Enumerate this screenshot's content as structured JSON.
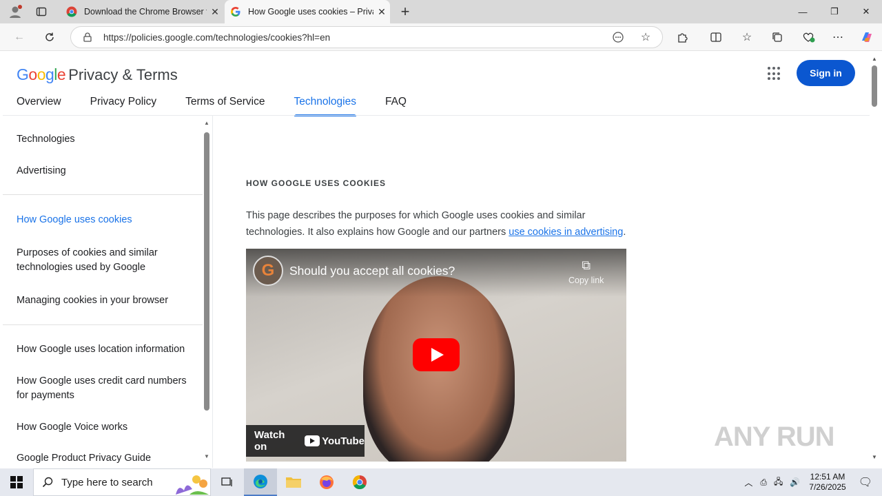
{
  "browser": {
    "tabs": [
      {
        "title": "Download the Chrome Browser for",
        "active": false
      },
      {
        "title": "How Google uses cookies – Privacy",
        "active": true
      }
    ],
    "url": "https://policies.google.com/technologies/cookies?hl=en"
  },
  "header": {
    "logo_google": "Google",
    "logo_suffix": "Privacy & Terms",
    "signin": "Sign in",
    "nav": [
      "Overview",
      "Privacy Policy",
      "Terms of Service",
      "Technologies",
      "FAQ"
    ],
    "active_nav": "Technologies"
  },
  "sidebar": {
    "items": [
      "Technologies",
      "Advertising",
      "How Google uses cookies",
      "Purposes of cookies and similar technologies used by Google",
      "Managing cookies in your browser",
      "How Google uses location information",
      "How Google uses credit card numbers for payments",
      "How Google Voice works",
      "Google Product Privacy Guide"
    ],
    "active_item": "How Google uses cookies"
  },
  "content": {
    "kicker": "HOW GOOGLE USES COOKIES",
    "para_before": "This page describes the purposes for which Google uses cookies and similar technologies. It also explains how Google and our partners ",
    "para_link": "use cookies in advertising",
    "para_after": ".",
    "video": {
      "channel_initial": "G",
      "title": "Should you accept all cookies?",
      "copy_link": "Copy link",
      "watch_on": "Watch on",
      "youtube": "YouTube"
    }
  },
  "watermark": "ANY RUN",
  "taskbar": {
    "search_placeholder": "Type here to search",
    "time": "12:51 AM",
    "date": "7/26/2025"
  }
}
